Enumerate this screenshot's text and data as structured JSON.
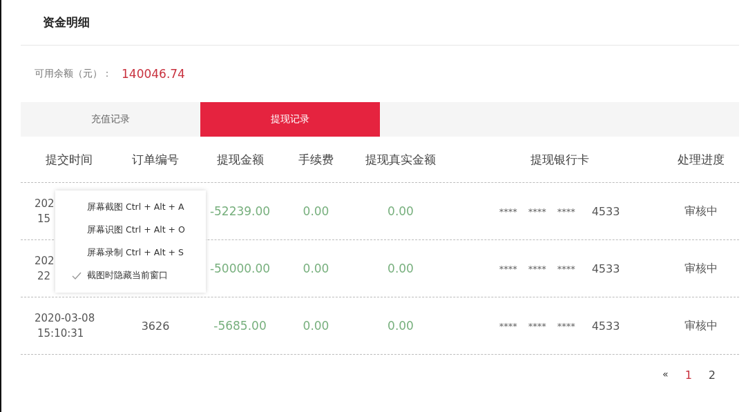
{
  "page_title": "资金明细",
  "balance": {
    "label": "可用余额（元）：",
    "value": "140046.74"
  },
  "tabs": [
    {
      "label": "充值记录",
      "selected": false
    },
    {
      "label": "提现记录",
      "selected": true
    }
  ],
  "table": {
    "columns": [
      "提交时间",
      "订单编号",
      "提现金额",
      "手续费",
      "提现真实金额",
      "提现银行卡",
      "处理进度"
    ],
    "rows": [
      {
        "time_date": "202",
        "time_clock": "15",
        "amount": "-52239.00",
        "fee": "0.00",
        "actual_amount": "0.00",
        "card": [
          "****",
          "****",
          "****",
          "4533"
        ],
        "status": "审核中"
      },
      {
        "time_date": "202",
        "time_clock": "22",
        "amount": "-50000.00",
        "fee": "0.00",
        "actual_amount": "0.00",
        "card": [
          "****",
          "****",
          "****",
          "4533"
        ],
        "status": "审核中"
      },
      {
        "time_date": "2020-03-08",
        "time_clock": "15:10:31",
        "order_no": "3626",
        "amount": "-5685.00",
        "fee": "0.00",
        "actual_amount": "0.00",
        "card": [
          "****",
          "****",
          "****",
          "4533"
        ],
        "status": "审核中"
      }
    ]
  },
  "pagination": [
    {
      "label": "«",
      "kind": "prev",
      "selected": false
    },
    {
      "label": "1",
      "kind": "page",
      "selected": true
    },
    {
      "label": "2",
      "kind": "page",
      "selected": false
    }
  ],
  "context_menu": [
    {
      "label": "屏幕截图",
      "shortcut": "Ctrl + Alt + A",
      "checked": false
    },
    {
      "label": "屏幕识图",
      "shortcut": "Ctrl + Alt + O",
      "checked": false
    },
    {
      "label": "屏幕录制",
      "shortcut": "Ctrl + Alt + S",
      "checked": false
    },
    {
      "label": "截图时隐藏当前窗口",
      "checked": true
    }
  ]
}
